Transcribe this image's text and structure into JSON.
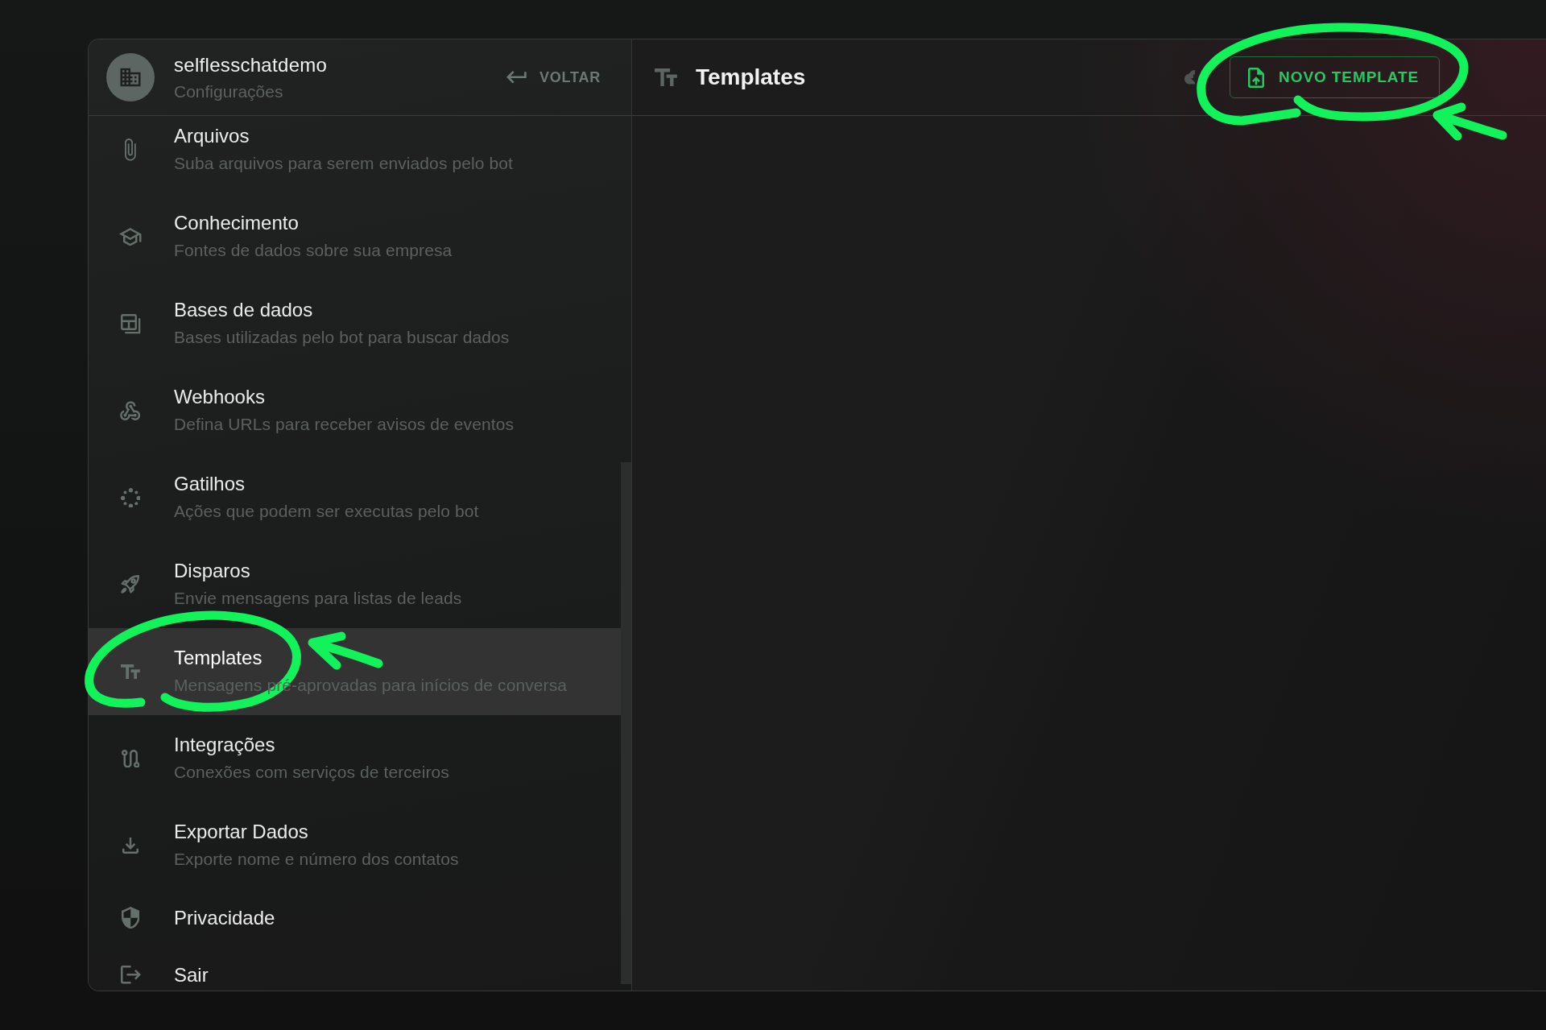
{
  "sidebar": {
    "account": {
      "name": "selflesschatdemo",
      "subtitle": "Configurações"
    },
    "back_button": {
      "label": "VOLTAR"
    },
    "items": [
      {
        "title": "Arquivos",
        "description": "Suba arquivos para serem enviados pelo bot",
        "selected": false
      },
      {
        "title": "Conhecimento",
        "description": "Fontes de dados sobre sua empresa",
        "selected": false
      },
      {
        "title": "Bases de dados",
        "description": "Bases utilizadas pelo bot para buscar dados",
        "selected": false
      },
      {
        "title": "Webhooks",
        "description": "Defina URLs para receber avisos de eventos",
        "selected": false
      },
      {
        "title": "Gatilhos",
        "description": "Ações que podem ser executas pelo bot",
        "selected": false
      },
      {
        "title": "Disparos",
        "description": "Envie mensagens para listas de leads",
        "selected": false
      },
      {
        "title": "Templates",
        "description": "Mensagens pré-aprovadas para inícios de conversa",
        "selected": true
      },
      {
        "title": "Integrações",
        "description": "Conexões com serviços de terceiros",
        "selected": false
      },
      {
        "title": "Exportar Dados",
        "description": "Exporte nome e número dos contatos",
        "selected": false
      },
      {
        "title": "Privacidade",
        "selected": false
      },
      {
        "title": "Sair",
        "selected": false
      }
    ]
  },
  "main": {
    "title": "Templates",
    "new_button": {
      "label": "NOVO TEMPLATE"
    }
  }
}
